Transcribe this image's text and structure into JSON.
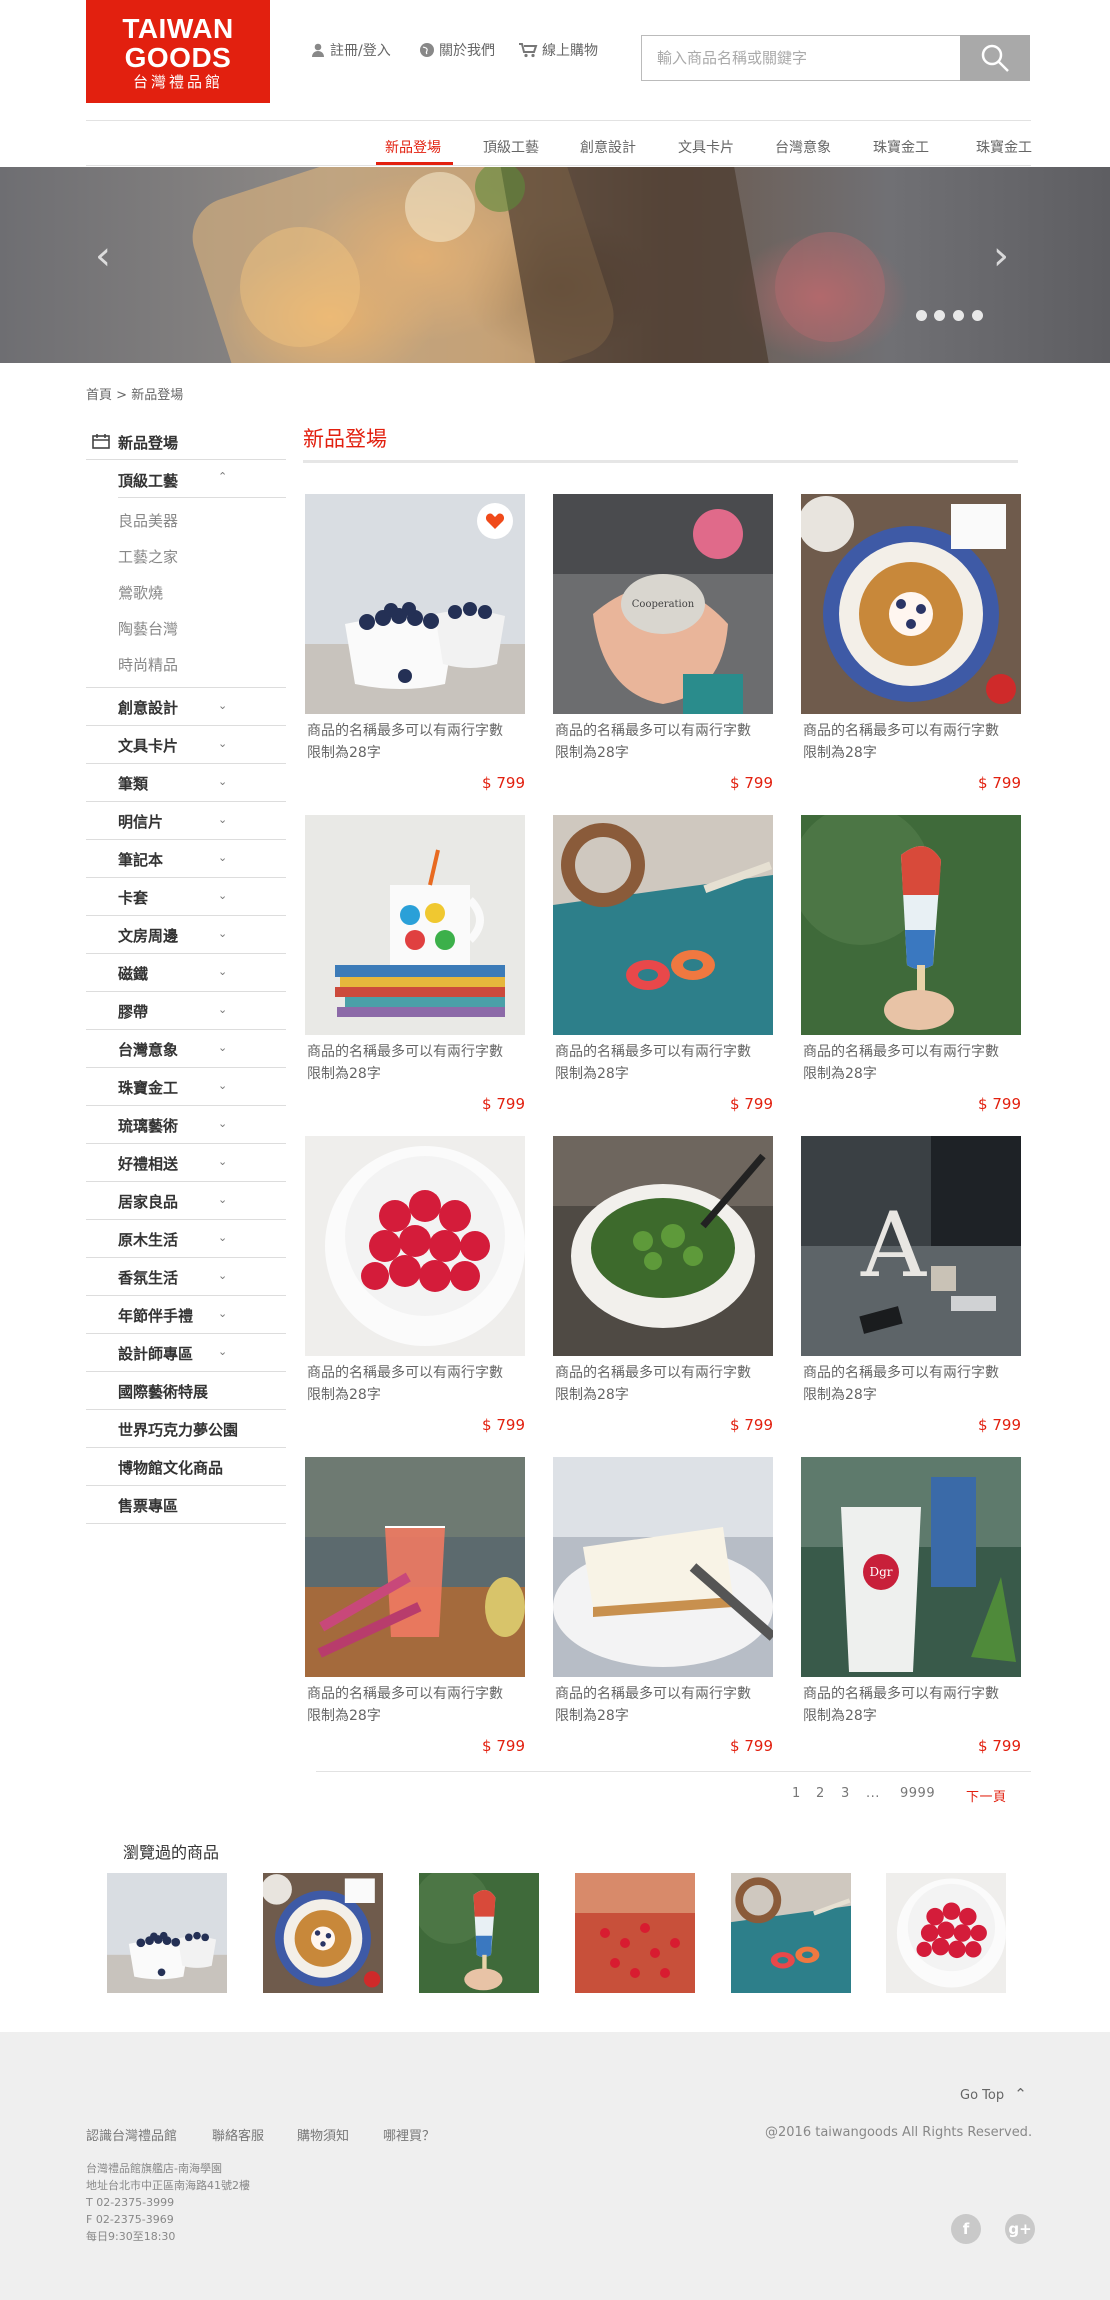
{
  "logo": {
    "line1": "TAIWAN",
    "line2": "GOODS",
    "line3": "台灣禮品館"
  },
  "header": {
    "links": [
      {
        "label": "註冊/登入",
        "icon": "user-icon"
      },
      {
        "label": "關於我們",
        "icon": "globe-icon"
      },
      {
        "label": "線上購物",
        "icon": "cart-icon"
      }
    ],
    "search_placeholder": "輸入商品名稱或關鍵字"
  },
  "topnav": [
    "新品登場",
    "頂級工藝",
    "創意設計",
    "文具卡片",
    "台灣意象",
    "珠寶金工",
    "珠寶金工"
  ],
  "breadcrumb": {
    "home": "首頁",
    "sep": ">",
    "current": "新品登場"
  },
  "sidebar": {
    "header": "新品登場",
    "expanded": "頂級工藝",
    "subitems": [
      "良品美器",
      "工藝之家",
      "鶯歌燒",
      "陶藝台灣",
      "時尚精品"
    ],
    "items": [
      "創意設計",
      "文具卡片",
      "筆類",
      "明信片",
      "筆記本",
      "卡套",
      "文房周邊",
      "磁鐵",
      "膠帶",
      "台灣意象",
      "珠寶金工",
      "琉璃藝術",
      "好禮相送",
      "居家良品",
      "原木生活",
      "香氛生活",
      "年節伴手禮",
      "設計師專區"
    ],
    "plain_items": [
      "國際藝術特展",
      "世界巧克力夢公園",
      "博物館文化商品",
      "售票專區"
    ]
  },
  "main": {
    "title": "新品登場",
    "products": [
      {
        "line1": "商品的名稱最多可以有兩行字數",
        "line2": "限制為28字",
        "price": "$ 799"
      },
      {
        "line1": "商品的名稱最多可以有兩行字數",
        "line2": "限制為28字",
        "price": "$ 799"
      },
      {
        "line1": "商品的名稱最多可以有兩行字數",
        "line2": "限制為28字",
        "price": "$ 799"
      },
      {
        "line1": "商品的名稱最多可以有兩行字數",
        "line2": "限制為28字",
        "price": "$ 799"
      },
      {
        "line1": "商品的名稱最多可以有兩行字數",
        "line2": "限制為28字",
        "price": "$ 799"
      },
      {
        "line1": "商品的名稱最多可以有兩行字數",
        "line2": "限制為28字",
        "price": "$ 799"
      },
      {
        "line1": "商品的名稱最多可以有兩行字數",
        "line2": "限制為28字",
        "price": "$ 799"
      },
      {
        "line1": "商品的名稱最多可以有兩行字數",
        "line2": "限制為28字",
        "price": "$ 799"
      },
      {
        "line1": "商品的名稱最多可以有兩行字數",
        "line2": "限制為28字",
        "price": "$ 799"
      },
      {
        "line1": "商品的名稱最多可以有兩行字數",
        "line2": "限制為28字",
        "price": "$ 799"
      },
      {
        "line1": "商品的名稱最多可以有兩行字數",
        "line2": "限制為28字",
        "price": "$ 799"
      },
      {
        "line1": "商品的名稱最多可以有兩行字數",
        "line2": "限制為28字",
        "price": "$ 799"
      }
    ]
  },
  "pagination": {
    "pages": [
      "1",
      "2",
      "3",
      "...",
      "9999"
    ],
    "next": "下一頁"
  },
  "viewed": {
    "title": "瀏覽過的商品"
  },
  "footer": {
    "gotop": "Go Top",
    "links": [
      "認識台灣禮品館",
      "聯絡客服",
      "購物須知",
      "哪裡買？"
    ],
    "copyright": "@2016 taiwangoods All Rights Reserved.",
    "address": [
      "台灣禮品館旗艦店-南海學園",
      "地址台北市中正區南海路41號2樓",
      "T  02-2375-3999",
      "F  02-2375-3969",
      "每日9:30至18:30"
    ],
    "social": [
      {
        "icon": "facebook-icon",
        "label": "f"
      },
      {
        "icon": "google-plus-icon",
        "label": "g+"
      }
    ]
  },
  "colors": {
    "brand": "#e2200f",
    "footer_bg": "#efefef"
  }
}
